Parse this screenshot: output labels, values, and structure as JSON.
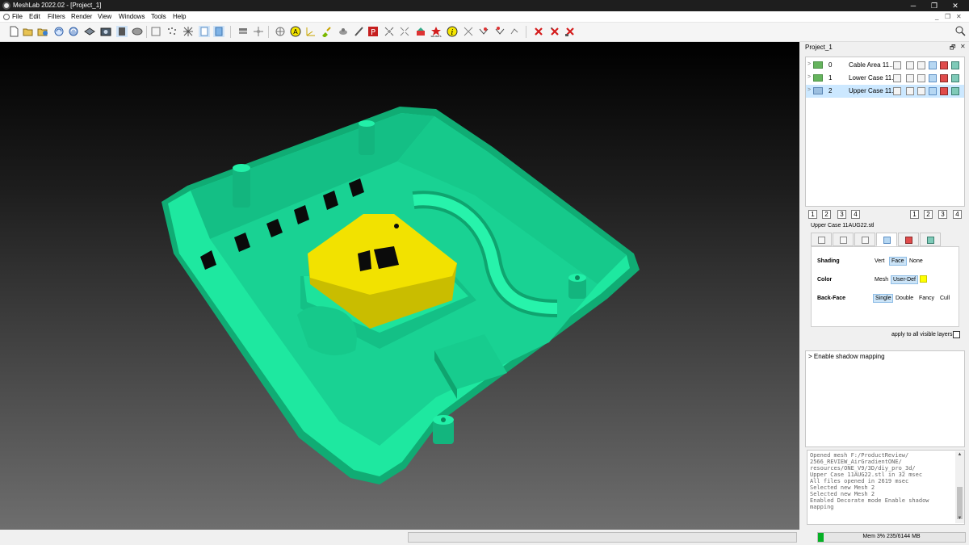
{
  "window": {
    "title": "MeshLab 2022.02 - [Project_1]",
    "controls": [
      "─",
      "❐",
      "✕"
    ]
  },
  "menu": {
    "items": [
      "File",
      "Edit",
      "Filters",
      "Render",
      "View",
      "Windows",
      "Tools",
      "Help"
    ],
    "mdi_controls": [
      "_",
      "❐",
      "✕"
    ]
  },
  "toolbar": {
    "icons": [
      "new-project",
      "open-project",
      "save-project",
      "reload",
      "reload-all",
      "import-mesh",
      "export-mesh",
      "snapshot",
      "bounding-box",
      "points",
      "wireframe",
      "flat-lines",
      "flat",
      "smooth",
      "layer-dialog",
      "raster-dialog",
      "measure",
      "annotate",
      "axes",
      "paint",
      "color-picker",
      "select-faces",
      "select-vertices",
      "align",
      "georef",
      "info",
      "pick-points",
      "stereo",
      "delete-faces",
      "delete-vertices",
      "delete-all"
    ]
  },
  "viewport": {
    "model_colors": {
      "case": "#1ee8a0",
      "case_dark": "#12b67c",
      "upper": "#f2e200",
      "upper_dark": "#c9bd00"
    }
  },
  "project": {
    "title": "Project_1",
    "controls": [
      "🗗",
      "✕"
    ],
    "layers": [
      {
        "index": "0",
        "name": "Cable Area 11...",
        "visible": true
      },
      {
        "index": "1",
        "name": "Lower Case 11...",
        "visible": true
      },
      {
        "index": "2",
        "name": "Upper Case 11...",
        "visible": false,
        "selected": true
      }
    ],
    "view_buttons_left": [
      "1",
      "2",
      "3",
      "4"
    ],
    "view_buttons_right": [
      "1",
      "2",
      "3",
      "4"
    ]
  },
  "render_panel": {
    "mesh_name": "Upper Case 11AUG22.stl",
    "shading": {
      "label": "Shading",
      "options": [
        "Vert",
        "Face",
        "None"
      ],
      "selected": "Face"
    },
    "color": {
      "label": "Color",
      "options": [
        "Mesh",
        "User-Def"
      ],
      "selected": "User-Def",
      "swatch": "#ffff00"
    },
    "backface": {
      "label": "Back-Face",
      "options": [
        "Single",
        "Double",
        "Fancy",
        "Cull"
      ],
      "selected": "Single"
    },
    "apply_all": "apply to all visible layers"
  },
  "decorators": {
    "items": [
      ">  Enable shadow mapping"
    ]
  },
  "log": {
    "lines": [
      "Opened mesh F:/ProductReview/",
      "2566_REVIEW_AirGradientONE/",
      "resources/ONE_V9/3D/diy_pro_3d/",
      "Upper Case 11AUG22.stl in 32 msec",
      "All files opened in 2619 msec",
      "Selected new Mesh 2",
      "Selected new Mesh 2",
      "Enabled Decorate mode Enable shadow",
      "mapping"
    ]
  },
  "status": {
    "memory": "Mem 3% 235/6144 MB",
    "memory_fraction": 0.04
  }
}
